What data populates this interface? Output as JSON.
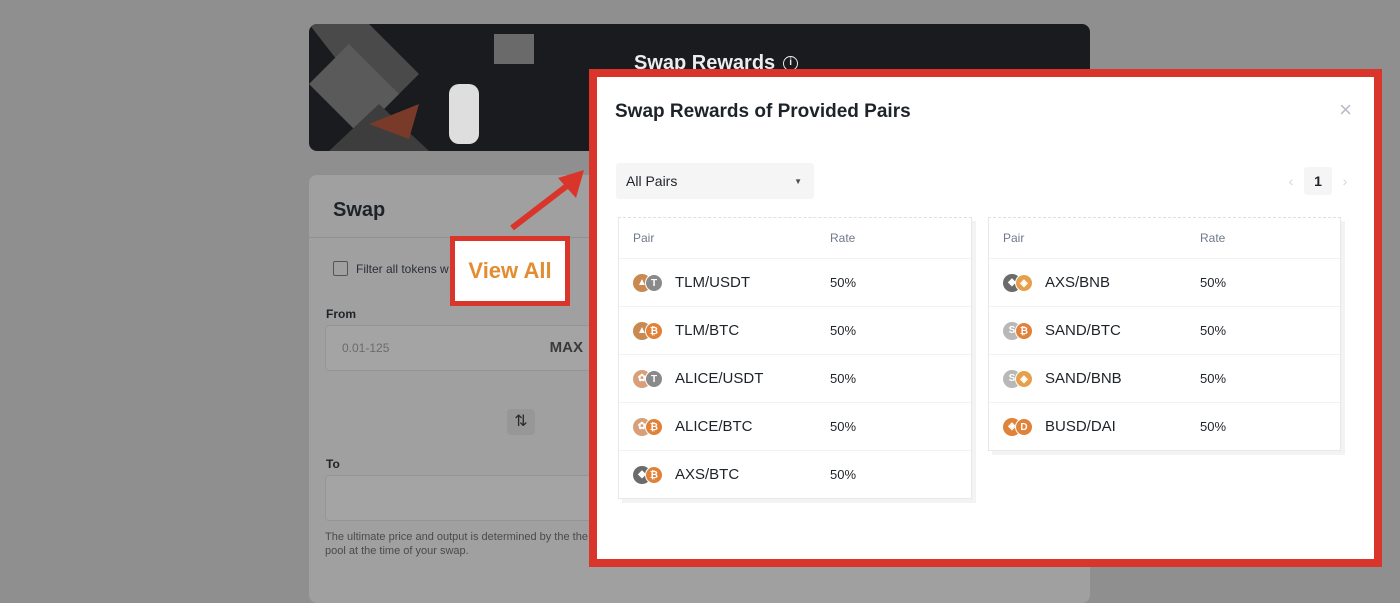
{
  "background": {
    "banner_title": "Swap Rewards",
    "swap_title": "Swap",
    "filter_label": "Filter all tokens w",
    "from_label": "From",
    "from_placeholder": "0.01-125",
    "max_label": "MAX",
    "swap_direction_icon": "swap-vertical-icon",
    "to_label": "To",
    "note": "The ultimate price and output is determined by the the pool at the time of your swap."
  },
  "callout": {
    "label": "View All",
    "color": "#e38d33",
    "frame_color": "#d9352a"
  },
  "modal": {
    "title": "Swap Rewards of Provided Pairs",
    "close_glyph": "×",
    "select": {
      "value": "All Pairs"
    },
    "pagination": {
      "prev": "‹",
      "current": "1",
      "next": "›"
    },
    "columns": {
      "pair": "Pair",
      "rate": "Rate"
    },
    "left_rows": [
      {
        "pair": "TLM/USDT",
        "rate": "50%"
      },
      {
        "pair": "TLM/BTC",
        "rate": "50%"
      },
      {
        "pair": "ALICE/USDT",
        "rate": "50%"
      },
      {
        "pair": "ALICE/BTC",
        "rate": "50%"
      },
      {
        "pair": "AXS/BTC",
        "rate": "50%"
      }
    ],
    "right_rows": [
      {
        "pair": "AXS/BNB",
        "rate": "50%"
      },
      {
        "pair": "SAND/BTC",
        "rate": "50%"
      },
      {
        "pair": "SAND/BNB",
        "rate": "50%"
      },
      {
        "pair": "BUSD/DAI",
        "rate": "50%"
      }
    ]
  }
}
